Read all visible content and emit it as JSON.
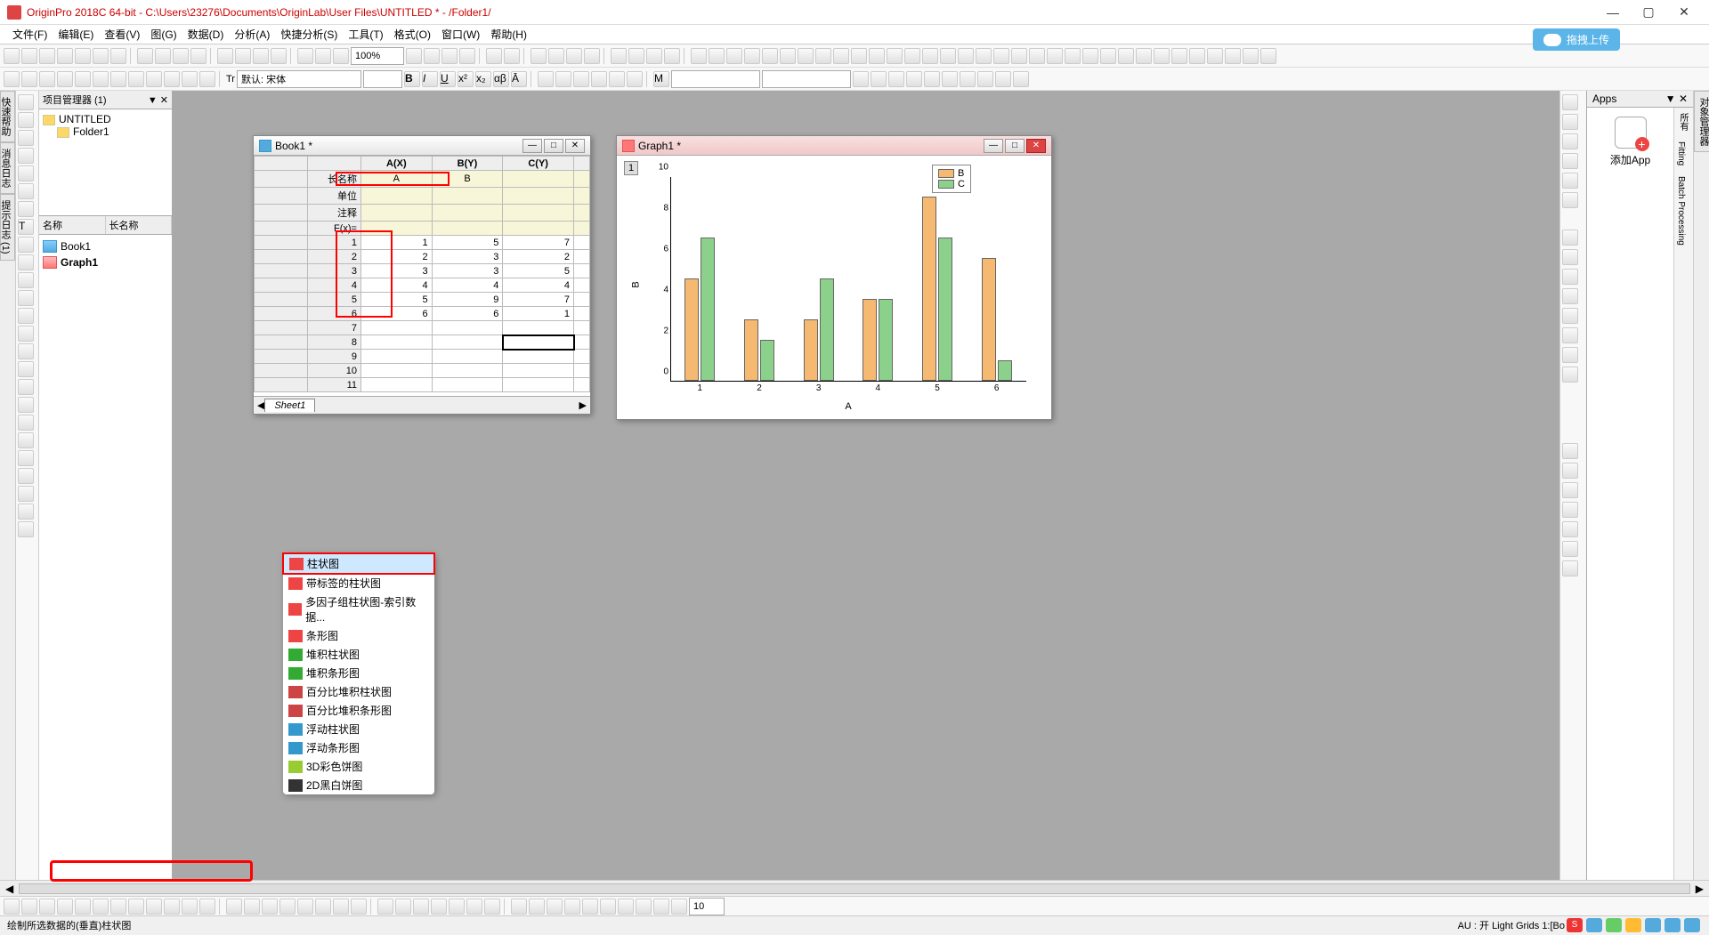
{
  "app": {
    "title": "OriginPro 2018C 64-bit - C:\\Users\\23276\\Documents\\OriginLab\\User Files\\UNTITLED * - /Folder1/"
  },
  "menu": [
    "文件(F)",
    "编辑(E)",
    "查看(V)",
    "图(G)",
    "数据(D)",
    "分析(A)",
    "快捷分析(S)",
    "工具(T)",
    "格式(O)",
    "窗口(W)",
    "帮助(H)"
  ],
  "upload": "拖拽上传",
  "zoom": "100%",
  "font_hint": "默认: 宋体",
  "project_explorer": {
    "title": "项目管理器 (1)",
    "root": "UNTITLED",
    "folder": "Folder1",
    "cols": {
      "name": "名称",
      "lname": "长名称"
    },
    "items": [
      {
        "name": "Book1",
        "type": "wb"
      },
      {
        "name": "Graph1",
        "type": "gr",
        "active": true
      }
    ]
  },
  "workbook": {
    "title": "Book1 *",
    "sheet": "Sheet1",
    "col_headers": [
      "A(X)",
      "B(Y)",
      "C(Y)"
    ],
    "label_rows": [
      "长名称",
      "单位",
      "注释",
      "F(x)="
    ],
    "longnames": [
      "A",
      "B",
      ""
    ],
    "data_rows": [
      [
        1,
        5,
        7
      ],
      [
        2,
        3,
        2
      ],
      [
        3,
        3,
        5
      ],
      [
        4,
        4,
        4
      ],
      [
        5,
        9,
        7
      ],
      [
        6,
        6,
        1
      ]
    ],
    "extra_rows": [
      7,
      8,
      9,
      10,
      11
    ],
    "selected_cell_row": 8
  },
  "graph": {
    "title": "Graph1 *",
    "layer": "1",
    "legend": [
      "B",
      "C"
    ],
    "xlabel": "A",
    "ylabel": "B"
  },
  "chart_data": {
    "type": "bar",
    "categories": [
      1,
      2,
      3,
      4,
      5,
      6
    ],
    "series": [
      {
        "name": "B",
        "values": [
          5,
          3,
          3,
          4,
          9,
          6
        ],
        "color": "#f5b971"
      },
      {
        "name": "C",
        "values": [
          7,
          2,
          5,
          4,
          7,
          1
        ],
        "color": "#8bd18b"
      }
    ],
    "xlabel": "A",
    "ylabel": "B",
    "ylim": [
      0,
      10
    ],
    "yticks": [
      0,
      2,
      4,
      6,
      8,
      10
    ]
  },
  "popup_menu": [
    "柱状图",
    "带标签的柱状图",
    "多因子组柱状图-索引数据...",
    "条形图",
    "堆积柱状图",
    "堆积条形图",
    "百分比堆积柱状图",
    "百分比堆积条形图",
    "浮动柱状图",
    "浮动条形图",
    "3D彩色饼图",
    "2D黑白饼图"
  ],
  "apps": {
    "title": "Apps",
    "add": "添加App",
    "tabs": [
      "所有",
      "Fitting",
      "Batch Processing"
    ]
  },
  "status": {
    "hint": "绘制所选数据的(垂直)柱状图",
    "right": "AU : 开  Light Grids 1:[Bo",
    "spin": "10"
  },
  "side_tabs_left": [
    "快速帮助",
    "消息日志",
    "提示日志 (1)"
  ],
  "side_tabs_right": [
    "对象管理器"
  ]
}
